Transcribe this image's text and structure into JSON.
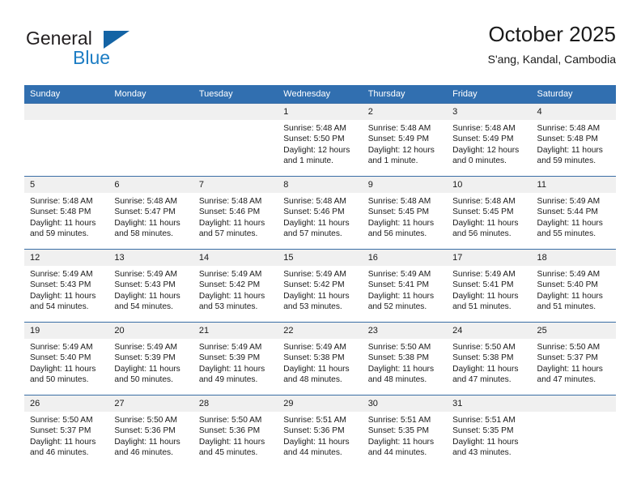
{
  "brand": {
    "name_part1": "General",
    "name_part2": "Blue",
    "triangle_color": "#1464a5",
    "blue_color": "#1d7dc4"
  },
  "header": {
    "month_title": "October 2025",
    "location": "S'ang, Kandal, Cambodia"
  },
  "theme": {
    "header_row_bg": "#316fb0",
    "daynum_bg": "#f0f0f0",
    "cell_border": "#3a6ea5",
    "text": "#1a1a1a"
  },
  "weekdays": [
    "Sunday",
    "Monday",
    "Tuesday",
    "Wednesday",
    "Thursday",
    "Friday",
    "Saturday"
  ],
  "weeks": [
    [
      {
        "day": "",
        "empty": true,
        "sunrise": "",
        "sunset": "",
        "daylight_line1": "",
        "daylight_line2": ""
      },
      {
        "day": "",
        "empty": true,
        "sunrise": "",
        "sunset": "",
        "daylight_line1": "",
        "daylight_line2": ""
      },
      {
        "day": "",
        "empty": true,
        "sunrise": "",
        "sunset": "",
        "daylight_line1": "",
        "daylight_line2": ""
      },
      {
        "day": "1",
        "empty": false,
        "sunrise": "Sunrise: 5:48 AM",
        "sunset": "Sunset: 5:50 PM",
        "daylight_line1": "Daylight: 12 hours",
        "daylight_line2": "and 1 minute."
      },
      {
        "day": "2",
        "empty": false,
        "sunrise": "Sunrise: 5:48 AM",
        "sunset": "Sunset: 5:49 PM",
        "daylight_line1": "Daylight: 12 hours",
        "daylight_line2": "and 1 minute."
      },
      {
        "day": "3",
        "empty": false,
        "sunrise": "Sunrise: 5:48 AM",
        "sunset": "Sunset: 5:49 PM",
        "daylight_line1": "Daylight: 12 hours",
        "daylight_line2": "and 0 minutes."
      },
      {
        "day": "4",
        "empty": false,
        "sunrise": "Sunrise: 5:48 AM",
        "sunset": "Sunset: 5:48 PM",
        "daylight_line1": "Daylight: 11 hours",
        "daylight_line2": "and 59 minutes."
      }
    ],
    [
      {
        "day": "5",
        "empty": false,
        "sunrise": "Sunrise: 5:48 AM",
        "sunset": "Sunset: 5:48 PM",
        "daylight_line1": "Daylight: 11 hours",
        "daylight_line2": "and 59 minutes."
      },
      {
        "day": "6",
        "empty": false,
        "sunrise": "Sunrise: 5:48 AM",
        "sunset": "Sunset: 5:47 PM",
        "daylight_line1": "Daylight: 11 hours",
        "daylight_line2": "and 58 minutes."
      },
      {
        "day": "7",
        "empty": false,
        "sunrise": "Sunrise: 5:48 AM",
        "sunset": "Sunset: 5:46 PM",
        "daylight_line1": "Daylight: 11 hours",
        "daylight_line2": "and 57 minutes."
      },
      {
        "day": "8",
        "empty": false,
        "sunrise": "Sunrise: 5:48 AM",
        "sunset": "Sunset: 5:46 PM",
        "daylight_line1": "Daylight: 11 hours",
        "daylight_line2": "and 57 minutes."
      },
      {
        "day": "9",
        "empty": false,
        "sunrise": "Sunrise: 5:48 AM",
        "sunset": "Sunset: 5:45 PM",
        "daylight_line1": "Daylight: 11 hours",
        "daylight_line2": "and 56 minutes."
      },
      {
        "day": "10",
        "empty": false,
        "sunrise": "Sunrise: 5:48 AM",
        "sunset": "Sunset: 5:45 PM",
        "daylight_line1": "Daylight: 11 hours",
        "daylight_line2": "and 56 minutes."
      },
      {
        "day": "11",
        "empty": false,
        "sunrise": "Sunrise: 5:49 AM",
        "sunset": "Sunset: 5:44 PM",
        "daylight_line1": "Daylight: 11 hours",
        "daylight_line2": "and 55 minutes."
      }
    ],
    [
      {
        "day": "12",
        "empty": false,
        "sunrise": "Sunrise: 5:49 AM",
        "sunset": "Sunset: 5:43 PM",
        "daylight_line1": "Daylight: 11 hours",
        "daylight_line2": "and 54 minutes."
      },
      {
        "day": "13",
        "empty": false,
        "sunrise": "Sunrise: 5:49 AM",
        "sunset": "Sunset: 5:43 PM",
        "daylight_line1": "Daylight: 11 hours",
        "daylight_line2": "and 54 minutes."
      },
      {
        "day": "14",
        "empty": false,
        "sunrise": "Sunrise: 5:49 AM",
        "sunset": "Sunset: 5:42 PM",
        "daylight_line1": "Daylight: 11 hours",
        "daylight_line2": "and 53 minutes."
      },
      {
        "day": "15",
        "empty": false,
        "sunrise": "Sunrise: 5:49 AM",
        "sunset": "Sunset: 5:42 PM",
        "daylight_line1": "Daylight: 11 hours",
        "daylight_line2": "and 53 minutes."
      },
      {
        "day": "16",
        "empty": false,
        "sunrise": "Sunrise: 5:49 AM",
        "sunset": "Sunset: 5:41 PM",
        "daylight_line1": "Daylight: 11 hours",
        "daylight_line2": "and 52 minutes."
      },
      {
        "day": "17",
        "empty": false,
        "sunrise": "Sunrise: 5:49 AM",
        "sunset": "Sunset: 5:41 PM",
        "daylight_line1": "Daylight: 11 hours",
        "daylight_line2": "and 51 minutes."
      },
      {
        "day": "18",
        "empty": false,
        "sunrise": "Sunrise: 5:49 AM",
        "sunset": "Sunset: 5:40 PM",
        "daylight_line1": "Daylight: 11 hours",
        "daylight_line2": "and 51 minutes."
      }
    ],
    [
      {
        "day": "19",
        "empty": false,
        "sunrise": "Sunrise: 5:49 AM",
        "sunset": "Sunset: 5:40 PM",
        "daylight_line1": "Daylight: 11 hours",
        "daylight_line2": "and 50 minutes."
      },
      {
        "day": "20",
        "empty": false,
        "sunrise": "Sunrise: 5:49 AM",
        "sunset": "Sunset: 5:39 PM",
        "daylight_line1": "Daylight: 11 hours",
        "daylight_line2": "and 50 minutes."
      },
      {
        "day": "21",
        "empty": false,
        "sunrise": "Sunrise: 5:49 AM",
        "sunset": "Sunset: 5:39 PM",
        "daylight_line1": "Daylight: 11 hours",
        "daylight_line2": "and 49 minutes."
      },
      {
        "day": "22",
        "empty": false,
        "sunrise": "Sunrise: 5:49 AM",
        "sunset": "Sunset: 5:38 PM",
        "daylight_line1": "Daylight: 11 hours",
        "daylight_line2": "and 48 minutes."
      },
      {
        "day": "23",
        "empty": false,
        "sunrise": "Sunrise: 5:50 AM",
        "sunset": "Sunset: 5:38 PM",
        "daylight_line1": "Daylight: 11 hours",
        "daylight_line2": "and 48 minutes."
      },
      {
        "day": "24",
        "empty": false,
        "sunrise": "Sunrise: 5:50 AM",
        "sunset": "Sunset: 5:38 PM",
        "daylight_line1": "Daylight: 11 hours",
        "daylight_line2": "and 47 minutes."
      },
      {
        "day": "25",
        "empty": false,
        "sunrise": "Sunrise: 5:50 AM",
        "sunset": "Sunset: 5:37 PM",
        "daylight_line1": "Daylight: 11 hours",
        "daylight_line2": "and 47 minutes."
      }
    ],
    [
      {
        "day": "26",
        "empty": false,
        "sunrise": "Sunrise: 5:50 AM",
        "sunset": "Sunset: 5:37 PM",
        "daylight_line1": "Daylight: 11 hours",
        "daylight_line2": "and 46 minutes."
      },
      {
        "day": "27",
        "empty": false,
        "sunrise": "Sunrise: 5:50 AM",
        "sunset": "Sunset: 5:36 PM",
        "daylight_line1": "Daylight: 11 hours",
        "daylight_line2": "and 46 minutes."
      },
      {
        "day": "28",
        "empty": false,
        "sunrise": "Sunrise: 5:50 AM",
        "sunset": "Sunset: 5:36 PM",
        "daylight_line1": "Daylight: 11 hours",
        "daylight_line2": "and 45 minutes."
      },
      {
        "day": "29",
        "empty": false,
        "sunrise": "Sunrise: 5:51 AM",
        "sunset": "Sunset: 5:36 PM",
        "daylight_line1": "Daylight: 11 hours",
        "daylight_line2": "and 44 minutes."
      },
      {
        "day": "30",
        "empty": false,
        "sunrise": "Sunrise: 5:51 AM",
        "sunset": "Sunset: 5:35 PM",
        "daylight_line1": "Daylight: 11 hours",
        "daylight_line2": "and 44 minutes."
      },
      {
        "day": "31",
        "empty": false,
        "sunrise": "Sunrise: 5:51 AM",
        "sunset": "Sunset: 5:35 PM",
        "daylight_line1": "Daylight: 11 hours",
        "daylight_line2": "and 43 minutes."
      },
      {
        "day": "",
        "empty": true,
        "sunrise": "",
        "sunset": "",
        "daylight_line1": "",
        "daylight_line2": ""
      }
    ]
  ]
}
